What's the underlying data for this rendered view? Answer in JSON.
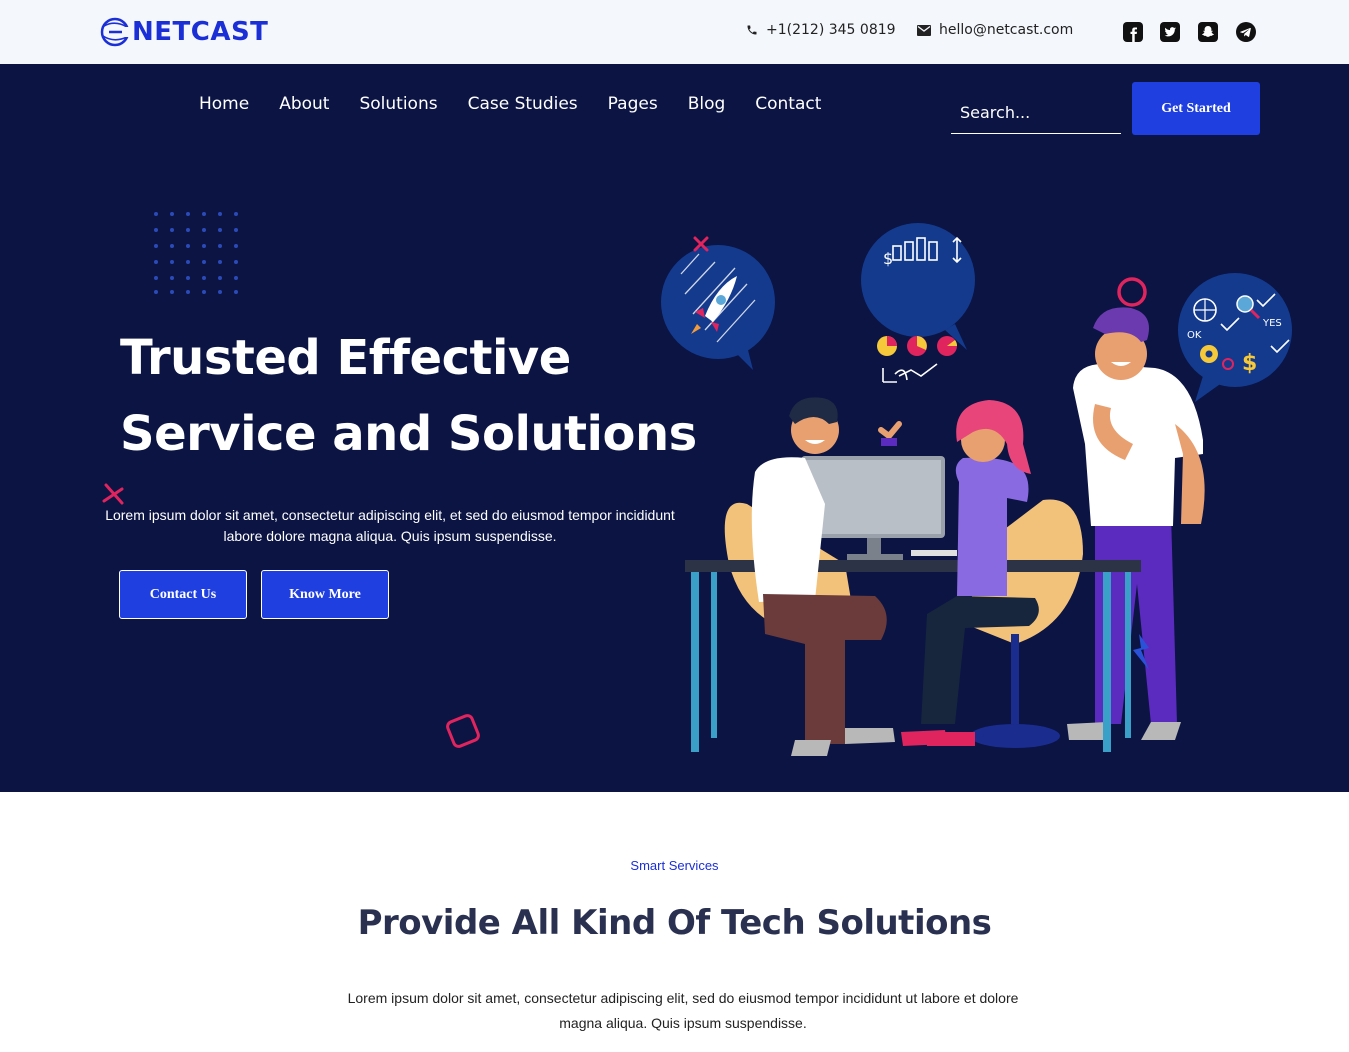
{
  "brand": {
    "name": "NETCAST",
    "color": "#1b2fd6"
  },
  "topbar": {
    "phone": "+1(212) 345 0819",
    "email": "hello@netcast.com",
    "social": [
      "facebook-icon",
      "twitter-icon",
      "snapchat-icon",
      "telegram-icon"
    ]
  },
  "nav": {
    "items": [
      "Home",
      "About",
      "Solutions",
      "Case Studies",
      "Pages",
      "Blog",
      "Contact"
    ],
    "search_placeholder": "Search...",
    "cta": "Get Started"
  },
  "hero": {
    "title_line1": "Trusted Effective",
    "title_line2": "Service and Solutions",
    "description": "Lorem ipsum dolor sit amet, consectetur adipiscing elit, et sed do eiusmod tempor incididunt labore dolore magna aliqua. Quis ipsum suspendisse.",
    "primary_button": "Contact Us",
    "secondary_button": "Know More",
    "bubble_labels": [
      "OK",
      "YES"
    ],
    "background": "#0b1443",
    "accent": "#1f3fe0"
  },
  "services": {
    "label": "Smart Services",
    "title": "Provide All Kind Of Tech Solutions",
    "description": "Lorem ipsum dolor sit amet, consectetur adipiscing elit, sed do eiusmod tempor incididunt ut labore et dolore magna aliqua. Quis ipsum suspendisse."
  }
}
